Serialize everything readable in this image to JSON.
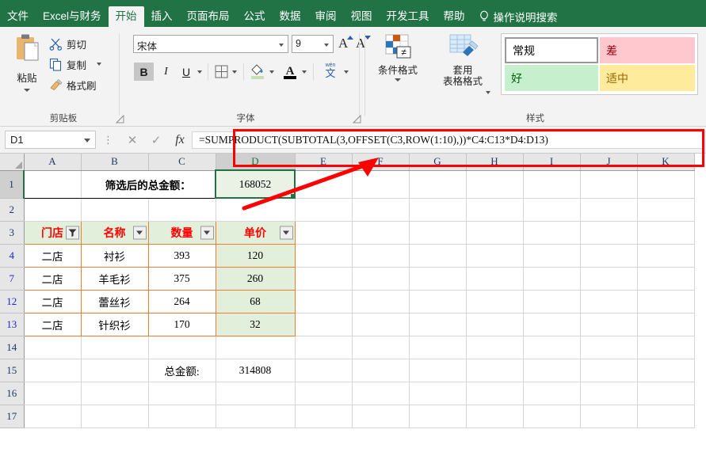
{
  "ribbon": {
    "tabs": [
      {
        "label": "文件",
        "active": false
      },
      {
        "label": "Excel与财务",
        "active": false
      },
      {
        "label": "开始",
        "active": true
      },
      {
        "label": "插入",
        "active": false
      },
      {
        "label": "页面布局",
        "active": false
      },
      {
        "label": "公式",
        "active": false
      },
      {
        "label": "数据",
        "active": false
      },
      {
        "label": "审阅",
        "active": false
      },
      {
        "label": "视图",
        "active": false
      },
      {
        "label": "开发工具",
        "active": false
      },
      {
        "label": "帮助",
        "active": false
      }
    ],
    "tell_me": "操作说明搜索",
    "tell_me_icon": "lightbulb-icon",
    "groups": {
      "clipboard": {
        "label": "剪贴板",
        "paste": "粘贴",
        "items": [
          {
            "label": "剪切",
            "icon": "scissors-icon"
          },
          {
            "label": "复制",
            "icon": "copy-icon"
          },
          {
            "label": "格式刷",
            "icon": "format-painter-icon"
          }
        ]
      },
      "font": {
        "label": "字体",
        "font_name": "宋体",
        "font_size": "9",
        "bold": "B",
        "italic": "I",
        "underline": "U",
        "grow_font": "A",
        "shrink_font": "A",
        "phonetic": "文"
      },
      "styles": {
        "label": "样式",
        "conditional_format": "条件格式",
        "format_as_table": "套用\n表格格式",
        "cell_styles": [
          {
            "label": "常规",
            "bg": "#ffffff",
            "color": "#000000"
          },
          {
            "label": "差",
            "bg": "#ffc7ce",
            "color": "#9c0006"
          },
          {
            "label": "好",
            "bg": "#c6efce",
            "color": "#006100"
          },
          {
            "label": "适中",
            "bg": "#ffeb9c",
            "color": "#9c6500"
          }
        ]
      }
    }
  },
  "formula_bar": {
    "name_box": "D1",
    "cancel_icon": "close-icon",
    "confirm_icon": "check-icon",
    "function_icon": "fx-icon",
    "formula": "=SUMPRODUCT(SUBTOTAL(3,OFFSET(C3,ROW(1:10),))*C4:C13*D4:D13)"
  },
  "grid": {
    "columns": [
      "A",
      "B",
      "C",
      "D",
      "E",
      "F",
      "G",
      "H",
      "I",
      "J",
      "K"
    ],
    "selected_column": "D",
    "selected_cell": "D1",
    "rows": [
      {
        "num": "1",
        "filtered": false,
        "cells": {
          "B": "筛选后的总金额：",
          "D": "168052"
        }
      },
      {
        "num": "2",
        "filtered": false,
        "cells": {}
      },
      {
        "num": "3",
        "filtered": false,
        "cells": {
          "A": "门店",
          "B": "名称",
          "C": "数量",
          "D": "单价"
        }
      },
      {
        "num": "4",
        "filtered": true,
        "cells": {
          "A": "二店",
          "B": "衬衫",
          "C": "393",
          "D": "120"
        }
      },
      {
        "num": "7",
        "filtered": true,
        "cells": {
          "A": "二店",
          "B": "羊毛衫",
          "C": "375",
          "D": "260"
        }
      },
      {
        "num": "12",
        "filtered": true,
        "cells": {
          "A": "二店",
          "B": "蕾丝衫",
          "C": "264",
          "D": "68"
        }
      },
      {
        "num": "13",
        "filtered": true,
        "cells": {
          "A": "二店",
          "B": "针织衫",
          "C": "170",
          "D": "32"
        }
      },
      {
        "num": "14",
        "filtered": false,
        "cells": {}
      },
      {
        "num": "15",
        "filtered": false,
        "cells": {
          "C": "总金额:",
          "D": "314808"
        }
      },
      {
        "num": "16",
        "filtered": false,
        "cells": {}
      },
      {
        "num": "17",
        "filtered": false,
        "cells": {}
      }
    ],
    "header_row_filters": [
      {
        "column": "A",
        "label": "门店",
        "icon": "filter-active-icon"
      },
      {
        "column": "B",
        "label": "名称",
        "icon": "filter-dropdown-icon"
      },
      {
        "column": "C",
        "label": "数量",
        "icon": "filter-dropdown-icon"
      },
      {
        "column": "D",
        "label": "单价",
        "icon": "filter-dropdown-icon"
      }
    ]
  },
  "annotations": {
    "highlight_rect": "red-rectangle-formula-bar",
    "arrow": "red-arrow-pointing-to-formula-bar",
    "color": "#ff0000"
  }
}
